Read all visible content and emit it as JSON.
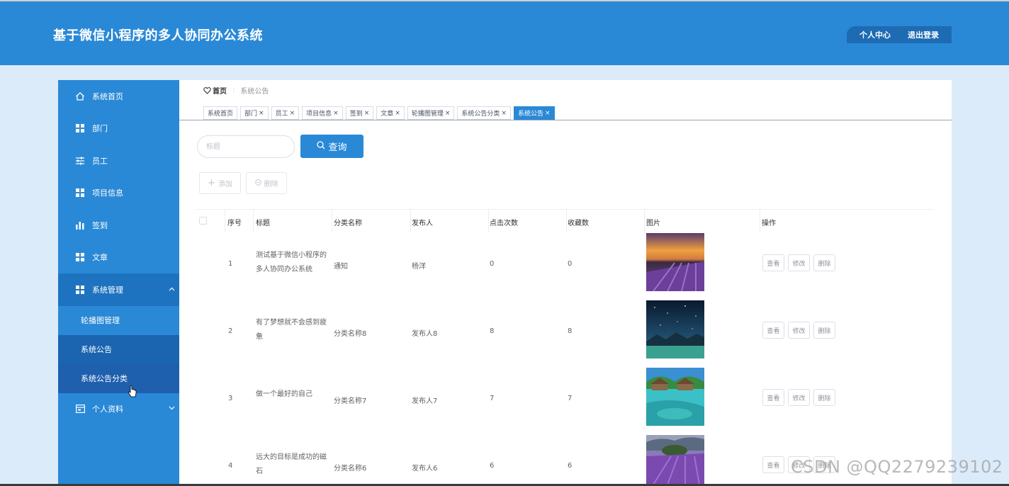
{
  "header": {
    "title": "基于微信小程序的多人协同办公系统",
    "personal_center": "个人中心",
    "logout": "退出登录"
  },
  "sidebar": {
    "items": [
      {
        "label": "系统首页",
        "icon": "home-icon"
      },
      {
        "label": "部门",
        "icon": "grid-icon"
      },
      {
        "label": "员工",
        "icon": "sliders-icon"
      },
      {
        "label": "项目信息",
        "icon": "grid-icon"
      },
      {
        "label": "签到",
        "icon": "bar-chart-icon"
      },
      {
        "label": "文章",
        "icon": "grid-icon"
      },
      {
        "label": "系统管理",
        "icon": "grid-icon"
      }
    ],
    "submenu": [
      "轮播图管理",
      "系统公告",
      "系统公告分类"
    ],
    "last_item": {
      "label": "个人资料",
      "icon": "card-icon"
    }
  },
  "breadcrumb": {
    "home": "首页",
    "current": "系统公告"
  },
  "tabs": [
    {
      "label": "系统首页",
      "closable": false
    },
    {
      "label": "部门",
      "closable": true
    },
    {
      "label": "员工",
      "closable": true
    },
    {
      "label": "项目信息",
      "closable": true
    },
    {
      "label": "签到",
      "closable": true
    },
    {
      "label": "文章",
      "closable": true
    },
    {
      "label": "轮播图管理",
      "closable": true
    },
    {
      "label": "系统公告分类",
      "closable": true
    },
    {
      "label": "系统公告",
      "closable": true,
      "active": true
    }
  ],
  "search": {
    "placeholder": "标题",
    "button": "查询"
  },
  "actions": {
    "add": "添加",
    "delete": "删除"
  },
  "table": {
    "headers": [
      "序号",
      "标题",
      "分类名称",
      "发布人",
      "点击次数",
      "收藏数",
      "图片",
      "操作"
    ],
    "rows": [
      {
        "index": "1",
        "title": "测试基于微信小程序的多人协同办公系统",
        "category": "通知",
        "publisher": "杨洋",
        "clicks": "0",
        "favorites": "0",
        "image": "sunset-lavender"
      },
      {
        "index": "2",
        "title": "有了梦想就不会感到疲惫",
        "category": "分类名称8",
        "publisher": "发布人8",
        "clicks": "8",
        "favorites": "8",
        "image": "starry-sky"
      },
      {
        "index": "3",
        "title": "做一个最好的自己",
        "category": "分类名称7",
        "publisher": "发布人7",
        "clicks": "7",
        "favorites": "7",
        "image": "tropical-water"
      },
      {
        "index": "4",
        "title": "远大的目标是成功的磁石",
        "category": "分类名称6",
        "publisher": "发布人6",
        "clicks": "6",
        "favorites": "6",
        "image": "lavender-field"
      }
    ],
    "ops": {
      "view": "查看",
      "edit": "修改",
      "delete": "删除"
    }
  },
  "watermark": "CSDN @QQ2279239102",
  "colors": {
    "primary": "#2a89d6",
    "background": "#dcebfa"
  }
}
